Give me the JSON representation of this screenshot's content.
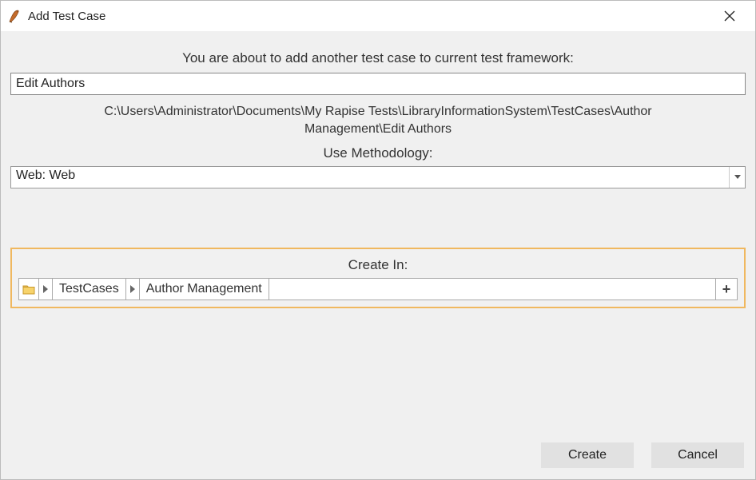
{
  "window": {
    "title": "Add Test Case"
  },
  "prompt": "You are about to add another test case to current test framework:",
  "testCaseName": "Edit Authors",
  "pathDisplay": "C:\\Users\\Administrator\\Documents\\My Rapise Tests\\LibraryInformationSystem\\TestCases\\Author Management\\Edit Authors",
  "methodology": {
    "label": "Use Methodology:",
    "selected": "Web: Web"
  },
  "createIn": {
    "label": "Create In:",
    "crumbs": [
      "TestCases",
      "Author Management"
    ]
  },
  "buttons": {
    "create": "Create",
    "cancel": "Cancel"
  }
}
